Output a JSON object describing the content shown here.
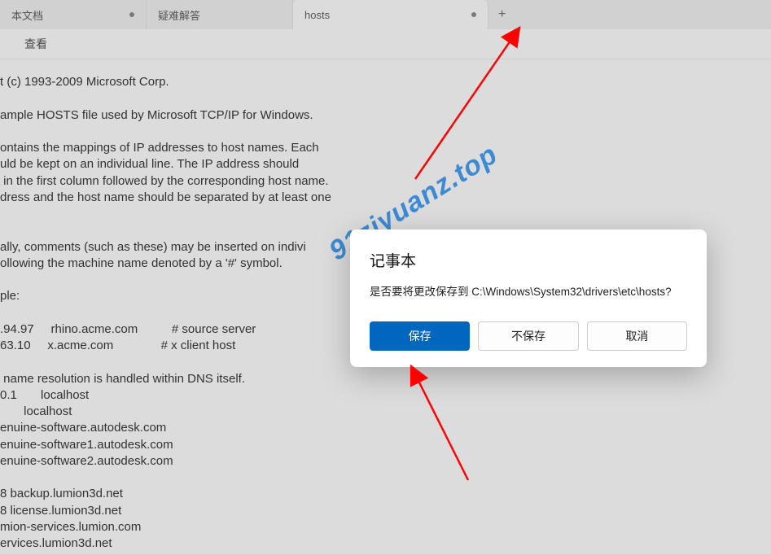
{
  "tabs": [
    {
      "label": "本文档",
      "modified": true
    },
    {
      "label": "疑难解答",
      "modified": false
    },
    {
      "label": "hosts",
      "modified": true,
      "active": true
    }
  ],
  "newtab_glyph": "+",
  "menubar": {
    "view": "查看"
  },
  "editor_text": "t (c) 1993-2009 Microsoft Corp.\n\nample HOSTS file used by Microsoft TCP/IP for Windows.\n\nontains the mappings of IP addresses to host names. Each\nuld be kept on an individual line. The IP address should\n in the first column followed by the corresponding host name.\ndress and the host name should be separated by at least one\n\n\nally, comments (such as these) may be inserted on indivi\nollowing the machine name denoted by a '#' symbol.\n\nple:\n\n.94.97     rhino.acme.com          # source server\n63.10     x.acme.com              # x client host\n\n name resolution is handled within DNS itself.\n0.1       localhost\n       localhost\nenuine-software.autodesk.com\nenuine-software1.autodesk.com\nenuine-software2.autodesk.com\n\n8 backup.lumion3d.net\n8 license.lumion3d.net\nmion-services.lumion.com\nervices.lumion3d.net",
  "dialog": {
    "title": "记事本",
    "message": "是否要将更改保存到 C:\\Windows\\System32\\drivers\\etc\\hosts?",
    "save": "保存",
    "dontsave": "不保存",
    "cancel": "取消"
  },
  "watermark": "91ziyuanz.top"
}
